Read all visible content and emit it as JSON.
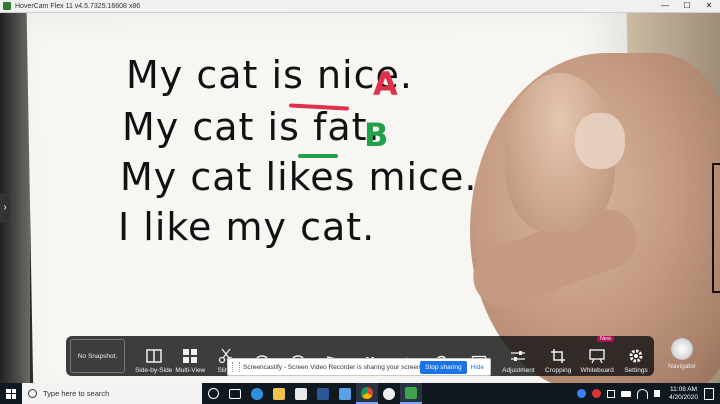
{
  "window": {
    "title": "HoverCam Flex 11 v4.5.7325.16608 x86",
    "minimize": "—",
    "maximize": "☐",
    "close": "✕"
  },
  "board": {
    "lines": [
      "My cat is nice.",
      "My cat is fat.",
      "My cat likes mice.",
      "I like my cat."
    ],
    "mark_a": "A",
    "mark_b": "B"
  },
  "toolbar": {
    "snapshot_label": "No Snapshot.",
    "tools": [
      {
        "label": "Side-by-Side",
        "icon": "side-by-side-icon"
      },
      {
        "label": "Multi-View",
        "icon": "grid-icon"
      },
      {
        "label": "Slings",
        "icon": "scissors-icon"
      },
      {
        "label": "",
        "icon": "aperture-icon"
      },
      {
        "label": "",
        "icon": "record-icon"
      },
      {
        "label": "",
        "icon": "film-icon"
      },
      {
        "label": "",
        "icon": "pause-icon"
      },
      {
        "label": "",
        "icon": "eye-icon"
      },
      {
        "label": "",
        "icon": "zoom-icon"
      },
      {
        "label": "",
        "icon": "expand-icon"
      },
      {
        "label": "Adjustment",
        "icon": "sliders-icon"
      },
      {
        "label": "Cropping",
        "icon": "crop-icon"
      },
      {
        "label": "Whiteboard",
        "icon": "whiteboard-icon",
        "badge": "New"
      },
      {
        "label": "Settings",
        "icon": "gear-icon"
      }
    ],
    "navigator_label": "Navigator"
  },
  "share_banner": {
    "message": "Screencastify - Screen Video Recorder is sharing your screen.",
    "stop_label": "Stop sharing",
    "hide_label": "Hide"
  },
  "taskbar": {
    "search_placeholder": "Type here to search",
    "time": "11:08 AM",
    "date": "4/20/2020"
  },
  "colors": {
    "mark_red": "#e0314a",
    "mark_green": "#22a14a",
    "share_blue": "#1a73e8",
    "taskbar": "#101820"
  }
}
